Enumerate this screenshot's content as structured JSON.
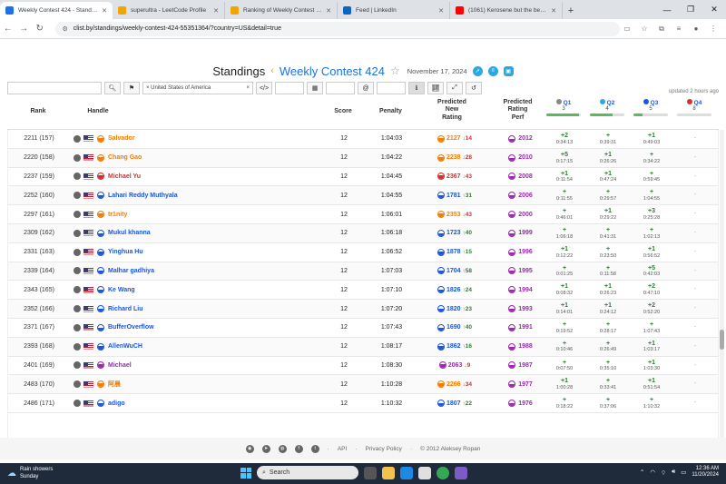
{
  "browser": {
    "tabs": [
      {
        "label": "Weekly Contest 424 - Standings",
        "color": "#1a73e8",
        "active": true
      },
      {
        "label": "superultra - LeetCode Profile",
        "color": "#f0a500",
        "active": false
      },
      {
        "label": "Ranking of Weekly Contest 424",
        "color": "#f0a500",
        "active": false
      },
      {
        "label": "Feed | LinkedIn",
        "color": "#0a66c2",
        "active": false
      },
      {
        "label": "(1061) Kerosene but the be…",
        "color": "#ff0000",
        "active": false
      }
    ],
    "url": "clist.by/standings/weekly-contest-424-55351364/?country=US&detail=true"
  },
  "header": {
    "title": "Standings",
    "contest": "Weekly Contest 424",
    "date": "November 17, 2024",
    "updated": "updated 2 hours ago"
  },
  "filters": {
    "country": "× United States of America",
    "country_clear": "×"
  },
  "columns": {
    "rank": "Rank",
    "handle": "Handle",
    "score": "Score",
    "penalty": "Penalty",
    "new_rating": "Predicted\nNew\nRating",
    "rating_perf": "Predicted\nRating\nPerf"
  },
  "problems": [
    {
      "name": "Q1",
      "points": "3",
      "solved_fraction": 0.95,
      "dot": "#888"
    },
    {
      "name": "Q2",
      "points": "4",
      "solved_fraction": 0.65,
      "dot": "#2aa8e0"
    },
    {
      "name": "Q3",
      "points": "5",
      "solved_fraction": 0.25,
      "dot": "#1a56db"
    },
    {
      "name": "Q4",
      "points": "8",
      "solved_fraction": 0.0,
      "dot": "#d32f2f"
    }
  ],
  "rows": [
    {
      "rank": "2211 (157)",
      "name": "Salvador",
      "color": "#f57c00",
      "score": "12",
      "penalty": "1:04:03",
      "rating": "2127",
      "delta": "14",
      "dir": "down",
      "perf": "2012",
      "perf_color": "#9c27b0",
      "q": [
        {
          "p": "+2",
          "t": "0:34:13"
        },
        {
          "p": "+",
          "t": "0:39:31"
        },
        {
          "p": "+1",
          "t": "0:49:03"
        },
        {
          "p": "-",
          "t": ""
        }
      ]
    },
    {
      "rank": "2220 (158)",
      "name": "Chang Gao",
      "color": "#f57c00",
      "score": "12",
      "penalty": "1:04:22",
      "rating": "2238",
      "delta": "28",
      "dir": "down",
      "perf": "2010",
      "perf_color": "#9c27b0",
      "q": [
        {
          "p": "+5",
          "t": "0:17:15"
        },
        {
          "p": "+1",
          "t": "0:26:26"
        },
        {
          "p": "+",
          "t": "0:34:22"
        },
        {
          "p": "-",
          "t": ""
        }
      ]
    },
    {
      "rank": "2237 (159)",
      "name": "Michael Yu",
      "color": "#d32f2f",
      "score": "12",
      "penalty": "1:04:45",
      "rating": "2367",
      "delta": "43",
      "dir": "down",
      "perf": "2008",
      "perf_color": "#9c27b0",
      "q": [
        {
          "p": "+1",
          "t": "0:11:54"
        },
        {
          "p": "+1",
          "t": "0:47:24"
        },
        {
          "p": "+",
          "t": "0:59:45"
        },
        {
          "p": "-",
          "t": ""
        }
      ]
    },
    {
      "rank": "2252 (160)",
      "name": "Lahari Reddy Muthyala",
      "color": "#1a56db",
      "score": "12",
      "penalty": "1:04:55",
      "rating": "1781",
      "delta": "31",
      "dir": "up",
      "perf": "2006",
      "perf_color": "#9c27b0",
      "q": [
        {
          "p": "+",
          "t": "0:11:55"
        },
        {
          "p": "+",
          "t": "0:29:57"
        },
        {
          "p": "+",
          "t": "1:04:55"
        },
        {
          "p": "-",
          "t": ""
        }
      ]
    },
    {
      "rank": "2297 (161)",
      "name": "tr1nity",
      "color": "#f57c00",
      "score": "12",
      "penalty": "1:06:01",
      "rating": "2353",
      "delta": "43",
      "dir": "down",
      "perf": "2000",
      "perf_color": "#9c27b0",
      "q": [
        {
          "p": "+",
          "t": "0:46:01"
        },
        {
          "p": "+1",
          "t": "0:29:22"
        },
        {
          "p": "+3",
          "t": "0:25:28"
        },
        {
          "p": "-",
          "t": ""
        }
      ]
    },
    {
      "rank": "2309 (162)",
      "name": "Mukul khanna",
      "color": "#1a56db",
      "score": "12",
      "penalty": "1:06:18",
      "rating": "1723",
      "delta": "40",
      "dir": "up",
      "perf": "1999",
      "perf_color": "#9c27b0",
      "q": [
        {
          "p": "+",
          "t": "1:06:18"
        },
        {
          "p": "+",
          "t": "0:41:31"
        },
        {
          "p": "+",
          "t": "1:02:13"
        },
        {
          "p": "-",
          "t": ""
        }
      ]
    },
    {
      "rank": "2331 (163)",
      "name": "Yinghua Hu",
      "color": "#1a56db",
      "score": "12",
      "penalty": "1:06:52",
      "rating": "1878",
      "delta": "15",
      "dir": "up",
      "perf": "1996",
      "perf_color": "#9c27b0",
      "q": [
        {
          "p": "+1",
          "t": "0:12:22"
        },
        {
          "p": "+",
          "t": "0:23:50"
        },
        {
          "p": "+1",
          "t": "0:56:52"
        },
        {
          "p": "-",
          "t": ""
        }
      ]
    },
    {
      "rank": "2339 (164)",
      "name": "Malhar gadhiya",
      "color": "#1a56db",
      "score": "12",
      "penalty": "1:07:03",
      "rating": "1704",
      "delta": "58",
      "dir": "up",
      "perf": "1995",
      "perf_color": "#9c27b0",
      "q": [
        {
          "p": "+",
          "t": "0:01:25"
        },
        {
          "p": "+",
          "t": "0:11:58"
        },
        {
          "p": "+5",
          "t": "0:42:03"
        },
        {
          "p": "-",
          "t": ""
        }
      ]
    },
    {
      "rank": "2343 (165)",
      "name": "Ke Wang",
      "color": "#1a56db",
      "score": "12",
      "penalty": "1:07:10",
      "rating": "1826",
      "delta": "24",
      "dir": "up",
      "perf": "1994",
      "perf_color": "#9c27b0",
      "q": [
        {
          "p": "+1",
          "t": "0:08:32"
        },
        {
          "p": "+1",
          "t": "0:26:23"
        },
        {
          "p": "+2",
          "t": "0:47:10"
        },
        {
          "p": "-",
          "t": ""
        }
      ]
    },
    {
      "rank": "2352 (166)",
      "name": "Richard Liu",
      "color": "#1a56db",
      "score": "12",
      "penalty": "1:07:20",
      "rating": "1820",
      "delta": "23",
      "dir": "up",
      "perf": "1993",
      "perf_color": "#9c27b0",
      "q": [
        {
          "p": "+1",
          "t": "0:14:01"
        },
        {
          "p": "+1",
          "t": "0:24:12"
        },
        {
          "p": "+2",
          "t": "0:52:20"
        },
        {
          "p": "-",
          "t": ""
        }
      ]
    },
    {
      "rank": "2371 (167)",
      "name": "BufferOverflow",
      "color": "#1a56db",
      "score": "12",
      "penalty": "1:07:43",
      "rating": "1690",
      "delta": "40",
      "dir": "up",
      "perf": "1991",
      "perf_color": "#9c27b0",
      "q": [
        {
          "p": "+",
          "t": "0:19:52"
        },
        {
          "p": "+",
          "t": "0:28:17"
        },
        {
          "p": "+",
          "t": "1:07:43"
        },
        {
          "p": "-",
          "t": ""
        }
      ]
    },
    {
      "rank": "2393 (168)",
      "name": "AllenWuCH",
      "color": "#1a56db",
      "score": "12",
      "penalty": "1:08:17",
      "rating": "1862",
      "delta": "16",
      "dir": "up",
      "perf": "1988",
      "perf_color": "#9c27b0",
      "q": [
        {
          "p": "+",
          "t": "0:10:46"
        },
        {
          "p": "+",
          "t": "0:26:49"
        },
        {
          "p": "+1",
          "t": "1:03:17"
        },
        {
          "p": "-",
          "t": ""
        }
      ]
    },
    {
      "rank": "2401 (169)",
      "name": "Michael",
      "color": "#9c27b0",
      "score": "12",
      "penalty": "1:08:30",
      "rating": "2063",
      "delta": "9",
      "dir": "down",
      "perf": "1987",
      "perf_color": "#9c27b0",
      "q": [
        {
          "p": "+",
          "t": "0:07:50"
        },
        {
          "p": "+",
          "t": "0:35:10"
        },
        {
          "p": "+1",
          "t": "1:03:30"
        },
        {
          "p": "-",
          "t": ""
        }
      ]
    },
    {
      "rank": "2483 (170)",
      "name": "阿晨",
      "color": "#f57c00",
      "score": "12",
      "penalty": "1:10:28",
      "rating": "2266",
      "delta": "34",
      "dir": "down",
      "perf": "1977",
      "perf_color": "#9c27b0",
      "q": [
        {
          "p": "+1",
          "t": "1:00:28"
        },
        {
          "p": "+",
          "t": "0:33:41"
        },
        {
          "p": "+1",
          "t": "0:51:54"
        },
        {
          "p": "-",
          "t": ""
        }
      ]
    },
    {
      "rank": "2486 (171)",
      "name": "adigo",
      "color": "#1a56db",
      "score": "12",
      "penalty": "1:10:32",
      "rating": "1807",
      "delta": "22",
      "dir": "up",
      "perf": "1976",
      "perf_color": "#9c27b0",
      "q": [
        {
          "p": "+",
          "t": "0:18:22"
        },
        {
          "p": "+",
          "t": "0:37:06"
        },
        {
          "p": "+",
          "t": "1:10:32"
        },
        {
          "p": "-",
          "t": ""
        }
      ]
    }
  ],
  "footer": {
    "api": "API",
    "privacy": "Privacy Policy",
    "copyright": "© 2012 Aleksey Ropan"
  },
  "taskbar": {
    "weather_title": "Rain showers",
    "weather_sub": "Sunday",
    "search": "Search",
    "time": "12:36 AM",
    "date": "11/20/2024"
  }
}
